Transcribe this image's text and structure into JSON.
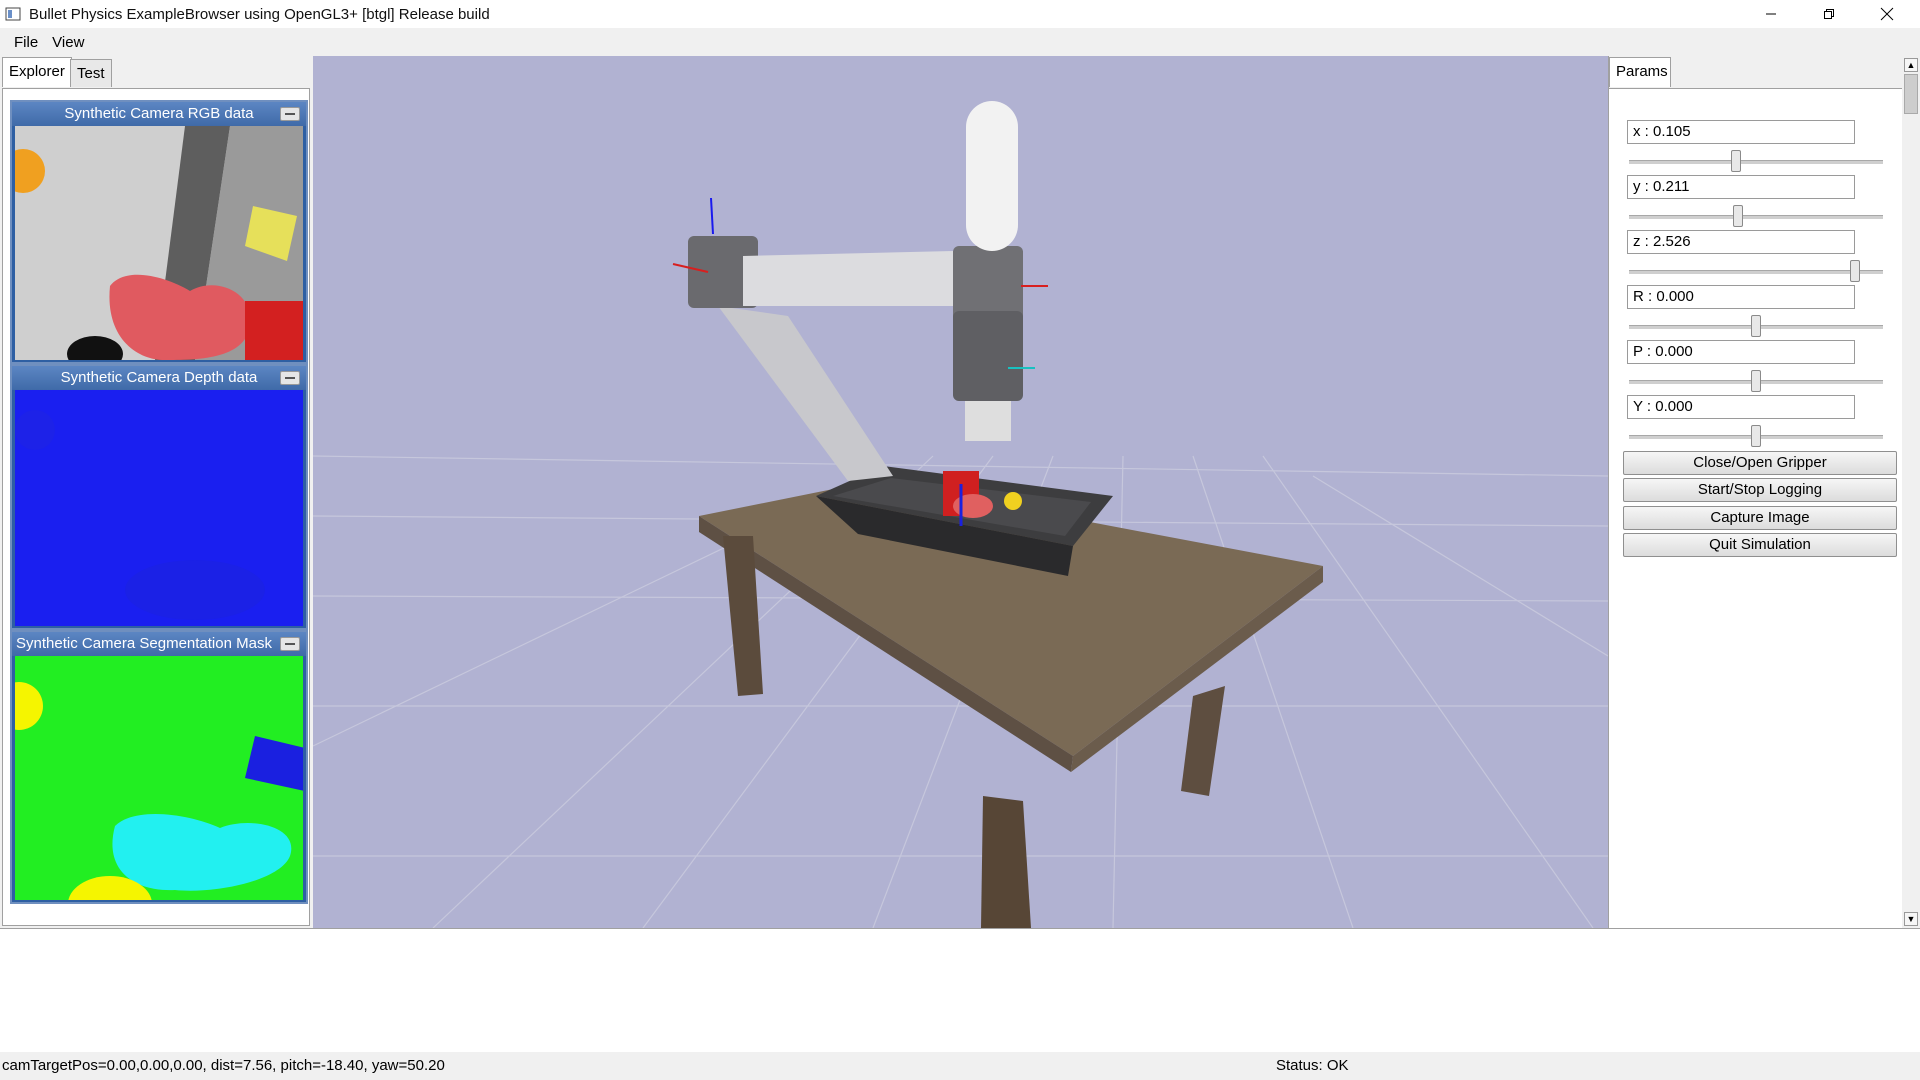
{
  "window": {
    "title": "Bullet Physics ExampleBrowser using OpenGL3+ [btgl] Release build",
    "controls": [
      "minimize-icon",
      "maximize-icon",
      "close-icon"
    ]
  },
  "menu": {
    "items": [
      "File",
      "View"
    ]
  },
  "left_panel": {
    "tabs": [
      "Explorer",
      "Test"
    ],
    "active_tab": "Explorer",
    "camera_windows": [
      {
        "title": "Synthetic Camera RGB data"
      },
      {
        "title": "Synthetic Camera Depth data"
      },
      {
        "title": "Synthetic Camera Segmentation Mask"
      }
    ]
  },
  "right_panel": {
    "tab": "Params",
    "params": [
      {
        "label": "x : 0.105",
        "slider_fraction": 0.42
      },
      {
        "label": "y : 0.211",
        "slider_fraction": 0.43
      },
      {
        "label": "z : 2.526",
        "slider_fraction": 0.89
      },
      {
        "label": "R : 0.000",
        "slider_fraction": 0.5
      },
      {
        "label": "P : 0.000",
        "slider_fraction": 0.5
      },
      {
        "label": "Y : 0.000",
        "slider_fraction": 0.5
      }
    ],
    "buttons": [
      "Close/Open Gripper",
      "Start/Stop Logging",
      "Capture Image",
      "Quit Simulation"
    ]
  },
  "status": {
    "camera": "camTargetPos=0.00,0.00,0.00, dist=7.56, pitch=-18.40, yaw=50.20",
    "state": "Status: OK"
  },
  "colors": {
    "viewport_background": "#b1b2d2",
    "depth_blue": "#1a1ff0",
    "segmentation_green": "#22ee22",
    "segmentation_cyan": "#22f0f0",
    "segmentation_yellow": "#f5f500",
    "segmentation_blue": "#1a20e0"
  }
}
